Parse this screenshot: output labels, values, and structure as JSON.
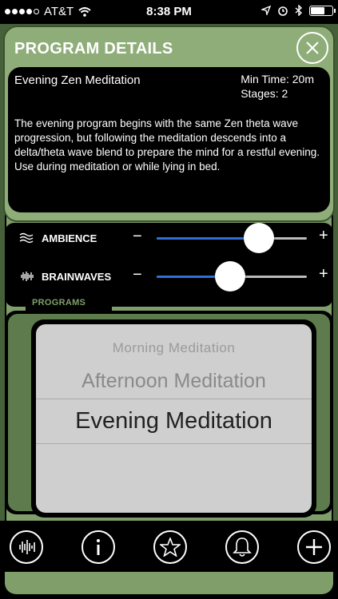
{
  "status_bar": {
    "carrier": "AT&T",
    "time": "8:38 PM"
  },
  "modal": {
    "title": "PROGRAM DETAILS",
    "program_name": "Evening Zen Meditation",
    "min_time": "Min Time: 20m",
    "stages": "Stages: 2",
    "description": "The evening program begins with the same Zen theta wave progression, but following the meditation descends into a delta/theta wave blend to prepare the mind for a restful evening.  Use during meditation or while lying in bed."
  },
  "controls": {
    "ambience": {
      "label": "AMBIENCE",
      "minus": "−",
      "plus": "+",
      "value": 0.68
    },
    "brainwaves": {
      "label": "BRAINWAVES",
      "minus": "−",
      "plus": "+",
      "value": 0.49
    }
  },
  "programs": {
    "tab_label": "PROGRAMS",
    "options": [
      "Morning Meditation",
      "Afternoon Meditation",
      "Evening Meditation"
    ],
    "selected": "Evening Meditation"
  },
  "bottom_bar": {
    "icons": [
      "soundwave-icon",
      "info-icon",
      "star-icon",
      "bell-icon",
      "plus-icon"
    ]
  },
  "colors": {
    "accent_green": "#7f9e6a",
    "dark_green": "#46603a",
    "slider_blue": "#2f6fd8"
  }
}
